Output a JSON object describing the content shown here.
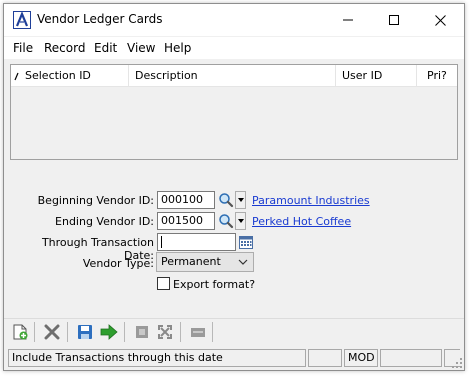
{
  "window": {
    "title": "Vendor Ledger Cards",
    "minimize_label": "",
    "accent_color": "#1f3f99"
  },
  "menu": {
    "items": [
      "File",
      "Record",
      "Edit",
      "View",
      "Help"
    ]
  },
  "list": {
    "columns": [
      "Selection ID",
      "Description",
      "User ID",
      "Pri?"
    ],
    "rows": []
  },
  "form": {
    "beginning_vendor": {
      "label": "Beginning Vendor ID:",
      "value": "000100",
      "name": "Paramount Industries"
    },
    "ending_vendor": {
      "label": "Ending Vendor ID:",
      "value": "001500",
      "name": "Perked Hot Coffee"
    },
    "through_date": {
      "label": "Through Transaction Date:",
      "value": ""
    },
    "vendor_type": {
      "label": "Vendor Type:",
      "selected": "Permanent"
    },
    "export_format": {
      "label": "Export format?",
      "checked": false
    }
  },
  "toolbar": {
    "icons": [
      "new-icon",
      "delete-icon",
      "save-icon",
      "run-icon",
      "print-icon",
      "fullscreen-icon",
      "close-panel-icon"
    ]
  },
  "status": {
    "message": "Include Transactions through this date",
    "cell2": "",
    "mode": "MOD",
    "cell4": "",
    "cell5": ""
  }
}
